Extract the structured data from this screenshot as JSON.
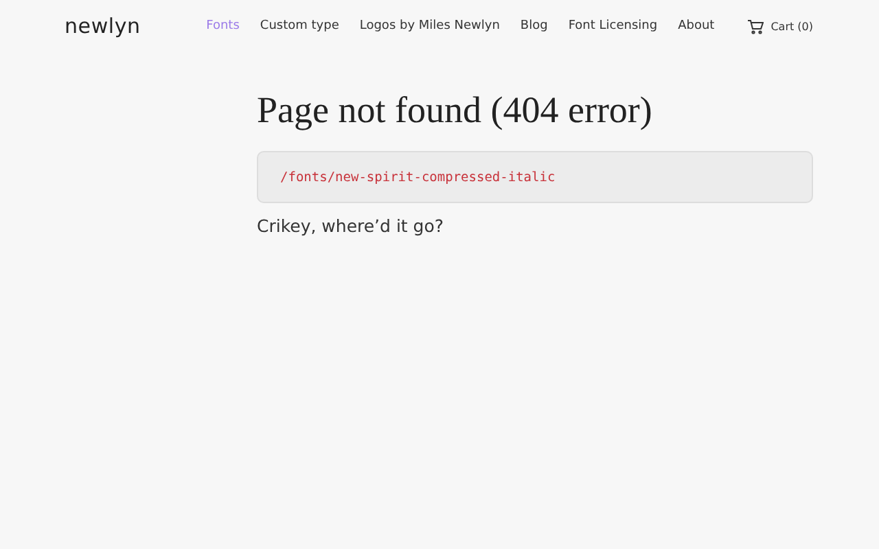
{
  "header": {
    "logo": "newlyn",
    "nav": [
      {
        "label": "Fonts",
        "selected": true
      },
      {
        "label": "Custom type",
        "selected": false
      },
      {
        "label": "Logos by Miles Newlyn",
        "selected": false
      },
      {
        "label": "Blog",
        "selected": false
      },
      {
        "label": "Font Licensing",
        "selected": false
      },
      {
        "label": "About",
        "selected": false
      }
    ],
    "cart": "Cart (0)"
  },
  "main": {
    "title": "Page not found (404 error)",
    "path": "/fonts/new-spirit-compressed-italic",
    "message": "Crikey, where’d it go?"
  }
}
